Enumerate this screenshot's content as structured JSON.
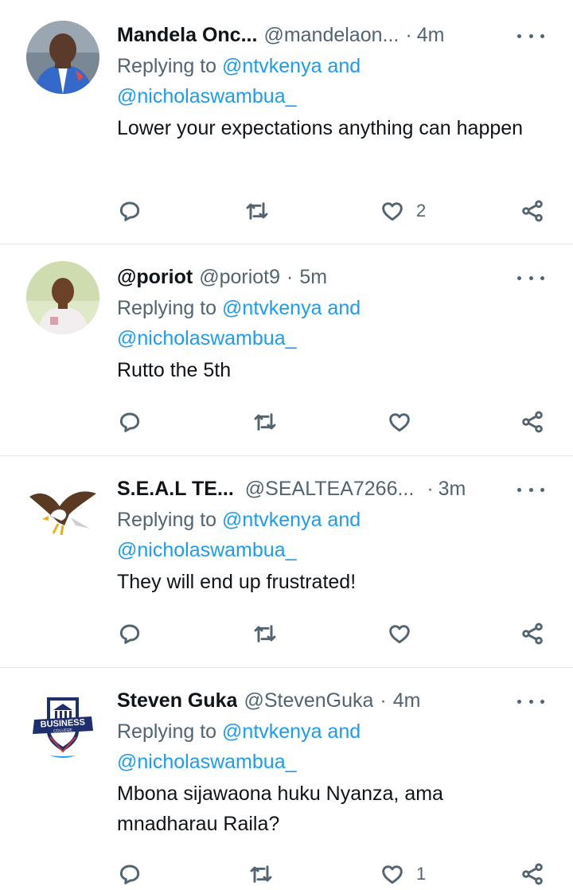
{
  "tweets": [
    {
      "name": "Mandela Onc...",
      "handle": "@mandelaon...",
      "dot": "·",
      "time": "4m",
      "replying_prefix": "Replying to ",
      "replying_first": "@ntvkenya",
      "replying_and": " and",
      "replying_second": "@nicholaswambua_",
      "text": "Lower your expectations anything can happen",
      "like_count": "2"
    },
    {
      "name": "@poriot",
      "handle": "@poriot9",
      "dot": "·",
      "time": "5m",
      "replying_prefix": "Replying to ",
      "replying_first": "@ntvkenya",
      "replying_and": " and",
      "replying_second": "@nicholaswambua_",
      "text": "Rutto the 5th",
      "like_count": ""
    },
    {
      "name": "S.E.A.L TE...",
      "handle": "@SEALTEA7266...",
      "dot": "·",
      "time": "3m",
      "replying_prefix": "Replying to ",
      "replying_first": "@ntvkenya",
      "replying_and": " and",
      "replying_second": "@nicholaswambua_",
      "text": "They will end up frustrated!",
      "like_count": ""
    },
    {
      "name": "Steven Guka",
      "handle": "@StevenGuka",
      "dot": "·",
      "time": "4m",
      "replying_prefix": "Replying to ",
      "replying_first": "@ntvkenya",
      "replying_and": " and",
      "replying_second": "@nicholaswambua_",
      "text": "Mbona sijawaona huku Nyanza, ama mnadharau Raila?",
      "like_count": "1",
      "avatar_badge_line1": "BUSINESS",
      "avatar_badge_line2": "COLLEGE"
    }
  ],
  "colors": {
    "link": "#1d9bf0",
    "secondary": "#536471",
    "divider": "#e6e9eb"
  },
  "icons": [
    "reply-icon",
    "retweet-icon",
    "like-icon",
    "share-icon",
    "more-icon"
  ]
}
